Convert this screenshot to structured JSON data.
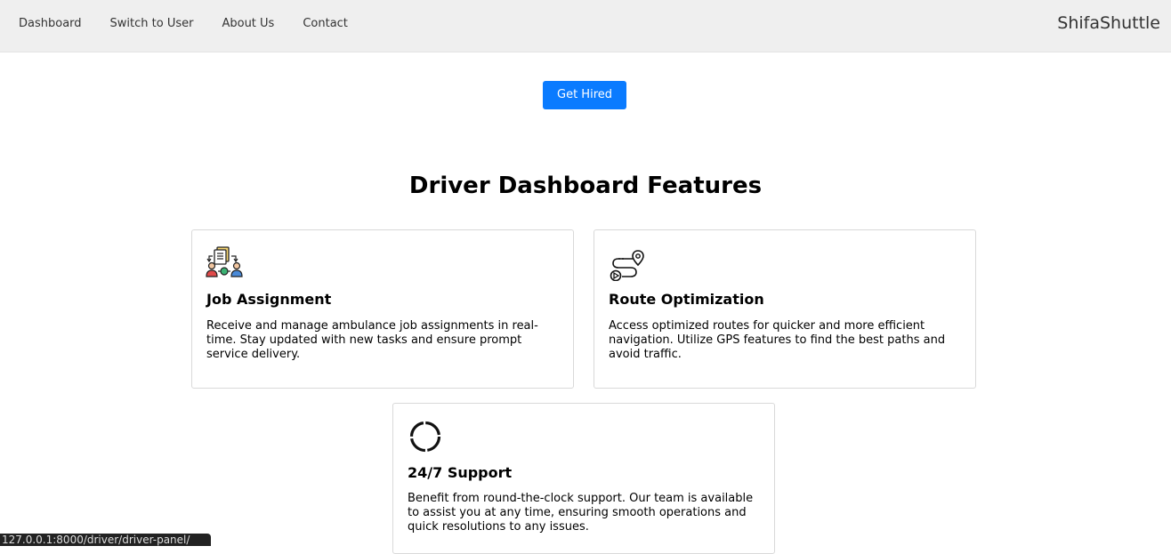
{
  "nav": {
    "links": [
      "Dashboard",
      "Switch to User",
      "About Us",
      "Contact"
    ],
    "brand": "ShifaShuttle"
  },
  "hero": {
    "button_label": "Get Hired",
    "button_color": "#0a7bff"
  },
  "features": {
    "title": "Driver Dashboard Features",
    "cards": [
      {
        "icon": "job-assignment-icon",
        "title": "Job Assignment",
        "text": "Receive and manage ambulance job assignments in real-time. Stay updated with new tasks and ensure prompt service delivery."
      },
      {
        "icon": "route-map-icon",
        "title": "Route Optimization",
        "text": "Access optimized routes for quicker and more efficient navigation. Utilize GPS features to find the best paths and avoid traffic."
      },
      {
        "icon": "loading-circle-icon",
        "title": "24/7 Support",
        "text": "Benefit from round-the-clock support. Our team is available to assist you at any time, ensuring smooth operations and quick resolutions to any issues."
      }
    ]
  },
  "status_bar": {
    "url": "127.0.0.1:8000/driver/driver-panel/"
  }
}
